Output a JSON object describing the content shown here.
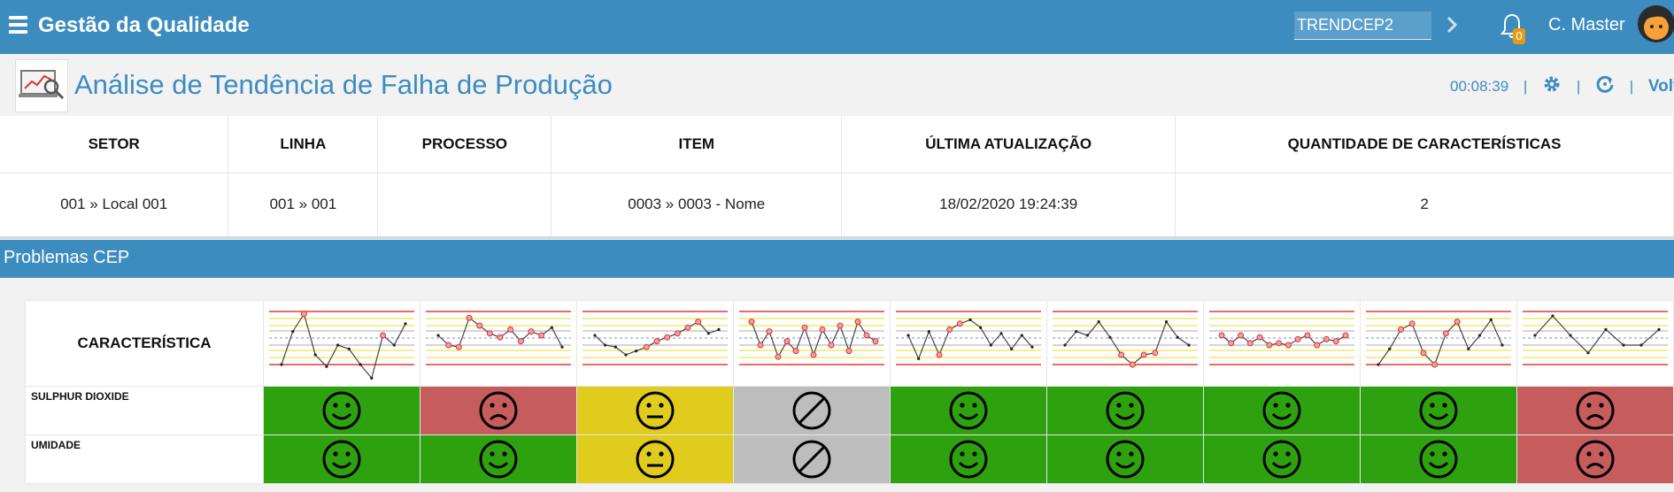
{
  "topbar": {
    "app_title": "Gestão da Qualidade",
    "search_value": "TRENDCEP2",
    "notification_count": "0",
    "user_name": "C. Master"
  },
  "page": {
    "title": "Análise de Tendência de Falha de Produção",
    "timer": "00:08:39",
    "back_label": "Voltar"
  },
  "info": {
    "headers": [
      "SETOR",
      "LINHA",
      "PROCESSO",
      "ITEM",
      "ÚLTIMA ATUALIZAÇÃO",
      "QUANTIDADE DE CARACTERÍSTICAS"
    ],
    "values": [
      "001 » Local 001",
      "001 » 001",
      "",
      "0003 » 0003 - Nome",
      "18/02/2020 19:24:39",
      "2"
    ]
  },
  "section_title": "Problemas CEP",
  "cep": {
    "header_label": "CARACTERÍSTICA",
    "rows": [
      {
        "label": "SULPHUR DIOXIDE",
        "statuses": [
          "ok",
          "bad",
          "warn",
          "na",
          "ok",
          "ok",
          "ok",
          "ok",
          "bad"
        ]
      },
      {
        "label": "UMIDADE",
        "statuses": [
          "ok",
          "ok",
          "warn",
          "na",
          "ok",
          "ok",
          "ok",
          "ok",
          "bad"
        ]
      }
    ]
  },
  "colors": {
    "primary": "#3d8cc0",
    "ok": "#2ea10f",
    "bad": "#c75c5c",
    "warn": "#dfcc1c",
    "na": "#bdbdbd"
  }
}
